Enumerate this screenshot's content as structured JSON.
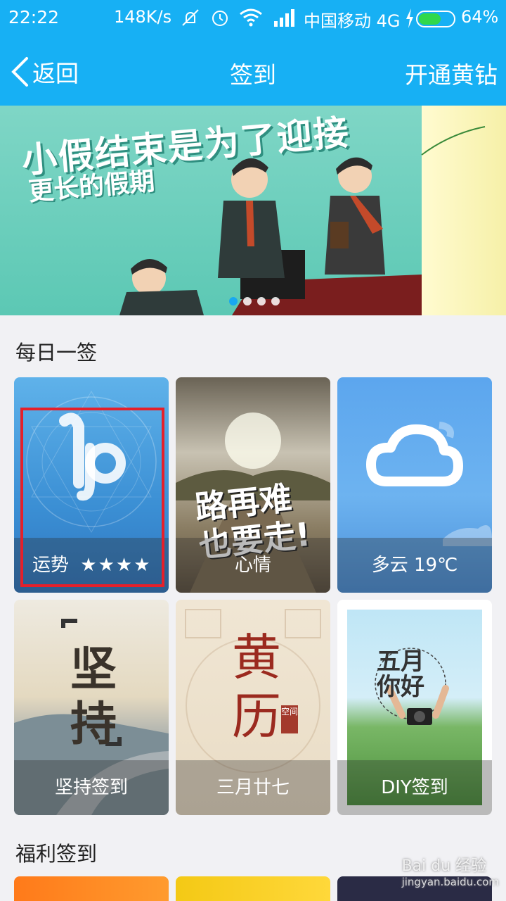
{
  "status_bar": {
    "time": "22:22",
    "speed": "148K/s",
    "carrier": "中国移动 4G",
    "battery_pct": "64%",
    "battery_level": 0.64,
    "icons": [
      "mute-icon",
      "alarm-icon",
      "wifi-icon",
      "signal-icon",
      "charging-icon"
    ]
  },
  "nav": {
    "back_label": "返回",
    "title": "签到",
    "right_label": "开通黄钻"
  },
  "banner": {
    "headline1": "小假结束是为了迎接",
    "headline2": "更长的假期",
    "page_count": 4,
    "active_index": 0
  },
  "daily": {
    "title": "每日一签",
    "cards": [
      {
        "caption": "运势",
        "stars": "★★★★",
        "art": "摩羯座"
      },
      {
        "caption": "心情",
        "art_text1": "路再难",
        "art_text2": "也要走!"
      },
      {
        "caption": "多云 19℃",
        "icon": "cloud-icon"
      },
      {
        "caption": "坚持签到",
        "art_text1": "坚",
        "art_text2": "持"
      },
      {
        "caption": "三月廿七",
        "art_text1": "黄",
        "art_text2": "历",
        "seal": "空间"
      },
      {
        "caption": "DIY签到",
        "art_text1": "五月",
        "art_text2": "你好"
      }
    ]
  },
  "welfare": {
    "title": "福利签到"
  },
  "watermark": {
    "brand": "Bai du 经验",
    "url": "jingyan.baidu.com"
  },
  "colors": {
    "header": "#17b0f4",
    "highlight_box": "#e5202a",
    "background": "#f1f1f4"
  }
}
